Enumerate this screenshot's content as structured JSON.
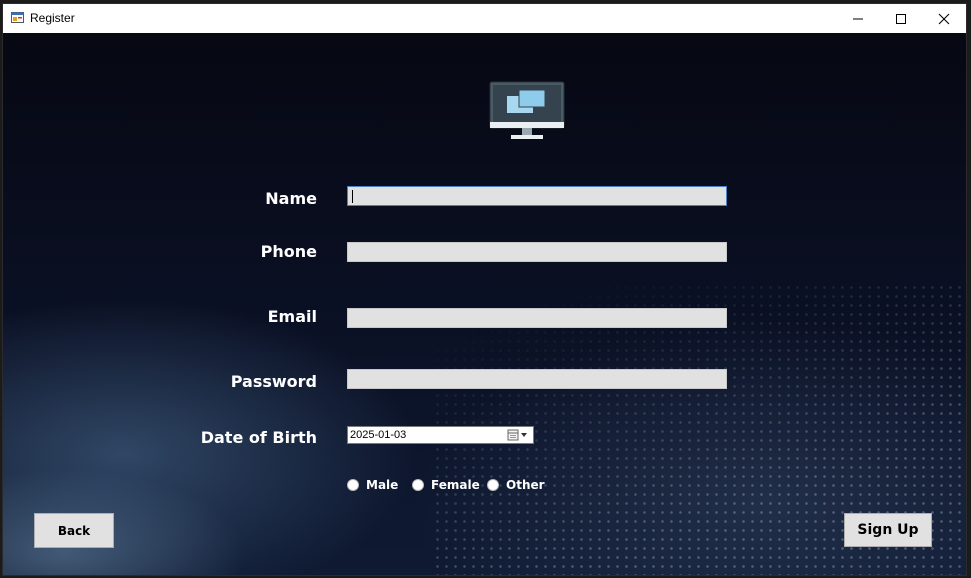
{
  "window": {
    "title": "Register"
  },
  "form": {
    "name_label": "Name",
    "phone_label": "Phone",
    "email_label": "Email",
    "password_label": "Password",
    "dob_label": "Date of Birth",
    "name_value": "",
    "phone_value": "",
    "email_value": "",
    "password_value": "",
    "dob_value": "2025-01-03"
  },
  "gender": {
    "options": [
      "Male",
      "Female",
      "Other"
    ]
  },
  "buttons": {
    "back": "Back",
    "signup": "Sign Up"
  },
  "colors": {
    "field_bg": "#e1e1e1",
    "button_bg": "#e1e1e1",
    "label_text": "#ffffff",
    "focus_border": "#4f7fc8",
    "background_dark": "#0b0e1c"
  },
  "icons": {
    "app": "form-icon",
    "header": "monitor-icon",
    "calendar": "calendar-icon"
  }
}
